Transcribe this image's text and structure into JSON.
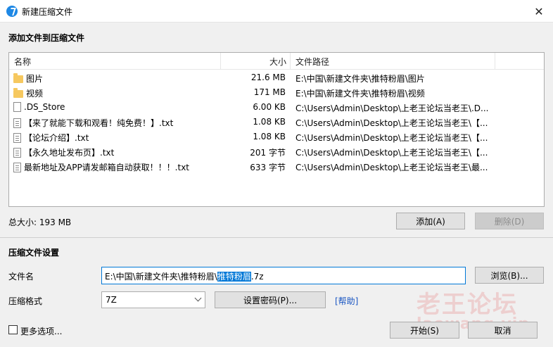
{
  "window": {
    "title": "新建压缩文件",
    "close_glyph": "✕"
  },
  "add_section": {
    "title": "添加文件到压缩文件"
  },
  "file_list": {
    "columns": {
      "name": "名称",
      "size": "大小",
      "path": "文件路径"
    },
    "rows": [
      {
        "icon": "folder-icon",
        "name": "图片",
        "size": "21.6 MB",
        "path": "E:\\中国\\新建文件夹\\推特粉眉\\图片"
      },
      {
        "icon": "folder-icon",
        "name": "视频",
        "size": "171 MB",
        "path": "E:\\中国\\新建文件夹\\推特粉眉\\视频"
      },
      {
        "icon": "file-icon",
        "name": ".DS_Store",
        "size": "6.00 KB",
        "path": "C:\\Users\\Admin\\Desktop\\上老王论坛当老王\\.D..."
      },
      {
        "icon": "txt-file-icon",
        "name": "【来了就能下载和观看！纯免费！】.txt",
        "size": "1.08 KB",
        "path": "C:\\Users\\Admin\\Desktop\\上老王论坛当老王\\【..."
      },
      {
        "icon": "txt-file-icon",
        "name": "【论坛介绍】.txt",
        "size": "1.08 KB",
        "path": "C:\\Users\\Admin\\Desktop\\上老王论坛当老王\\【..."
      },
      {
        "icon": "txt-file-icon",
        "name": "【永久地址发布页】.txt",
        "size": "201 字节",
        "path": "C:\\Users\\Admin\\Desktop\\上老王论坛当老王\\【..."
      },
      {
        "icon": "txt-file-icon",
        "name": "最新地址及APP请发邮箱自动获取！！！.txt",
        "size": "633 字节",
        "path": "C:\\Users\\Admin\\Desktop\\上老王论坛当老王\\最..."
      }
    ]
  },
  "summary": {
    "total_size": "总大小: 193 MB"
  },
  "buttons": {
    "add": "添加(A)",
    "delete": "删除(D)",
    "browse": "浏览(B)...",
    "set_password": "设置密码(P)...",
    "ok": "开始(S)",
    "cancel": "取消"
  },
  "settings": {
    "title": "压缩文件设置",
    "filename_label": "文件名",
    "filename_prefix": "E:\\中国\\新建文件夹\\推特粉眉\\",
    "filename_selected": "推特粉眉",
    "filename_suffix": ".7z",
    "format_label": "压缩格式",
    "format_value": "7Z",
    "help_link": "[帮助]"
  },
  "more_options": {
    "label": "更多选项..."
  },
  "watermark": {
    "line1": "老王论坛",
    "line2": "laowang.vip"
  }
}
